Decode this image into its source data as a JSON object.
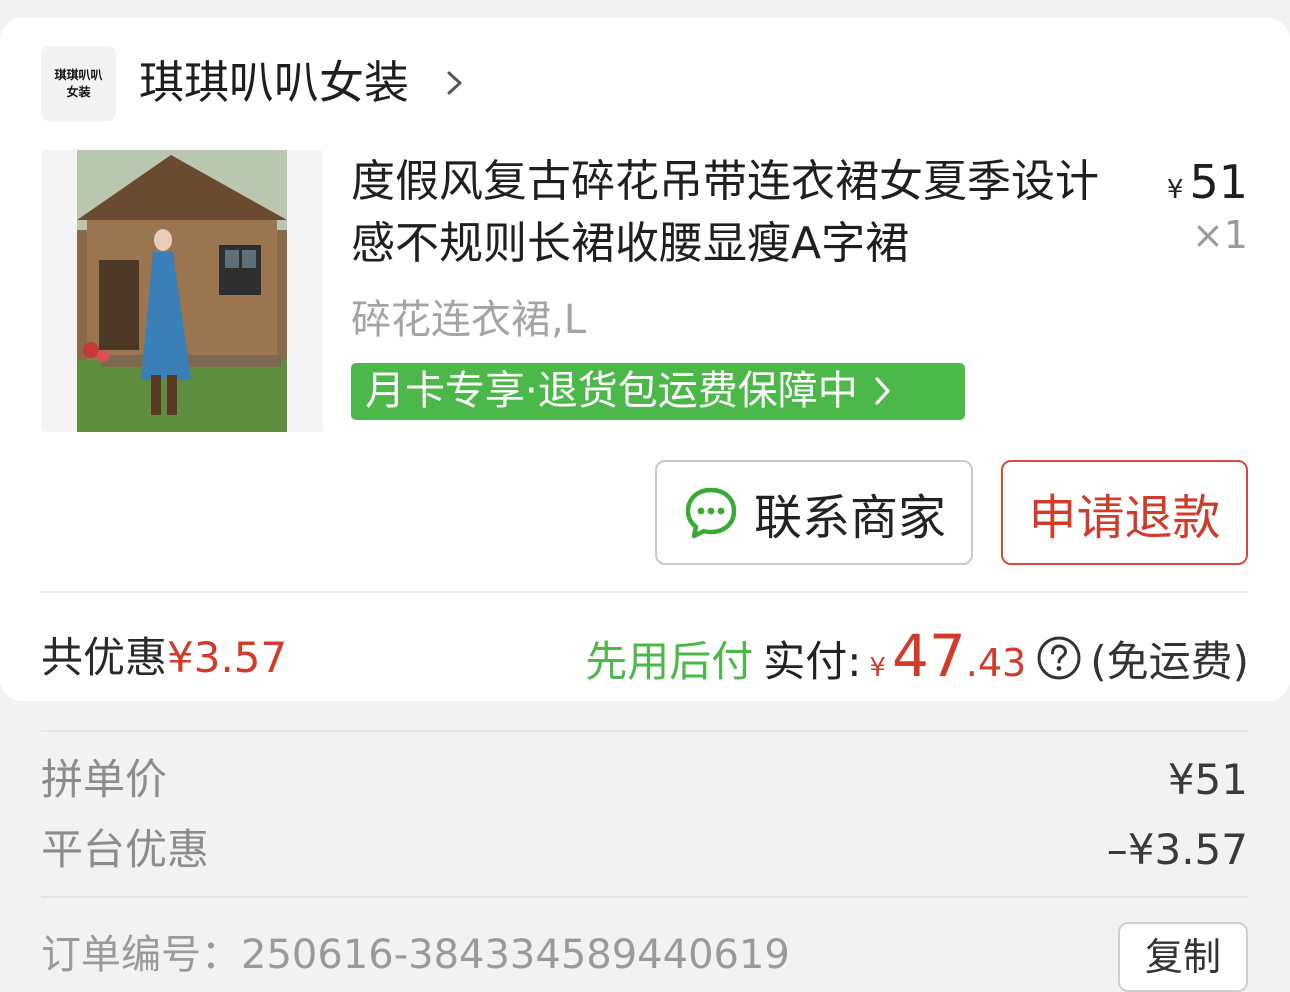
{
  "shop": {
    "logo_line1": "琪琪叭叭",
    "logo_line2": "女装",
    "name": "琪琪叭叭女装"
  },
  "product": {
    "title": "度假风复古碎花吊带连衣裙女夏季设计感不规则长裙收腰显瘦A字裙",
    "price_symbol": "¥",
    "price": "51",
    "quantity": "×1",
    "spec": "碎花连衣裙,L",
    "tag": "月卡专享·退货包运费保障中"
  },
  "actions": {
    "contact_label": "联系商家",
    "refund_label": "申请退款"
  },
  "summary": {
    "discount_label": "共优惠",
    "discount_value": "¥3.57",
    "pay_later": "先用后付",
    "paid_label": "实付:",
    "paid_symbol": "¥",
    "paid_int": "47",
    "paid_dec": ".43",
    "shipping": "(免运费)"
  },
  "details": {
    "group_price_label": "拼单价",
    "group_price_value": "¥51",
    "platform_discount_label": "平台优惠",
    "platform_discount_value": "–¥3.57"
  },
  "order": {
    "number_text": "订单编号：250616-384334589440619",
    "copy_label": "复制"
  },
  "colors": {
    "accent_red": "#d23b2b",
    "accent_green": "#4cb849"
  }
}
